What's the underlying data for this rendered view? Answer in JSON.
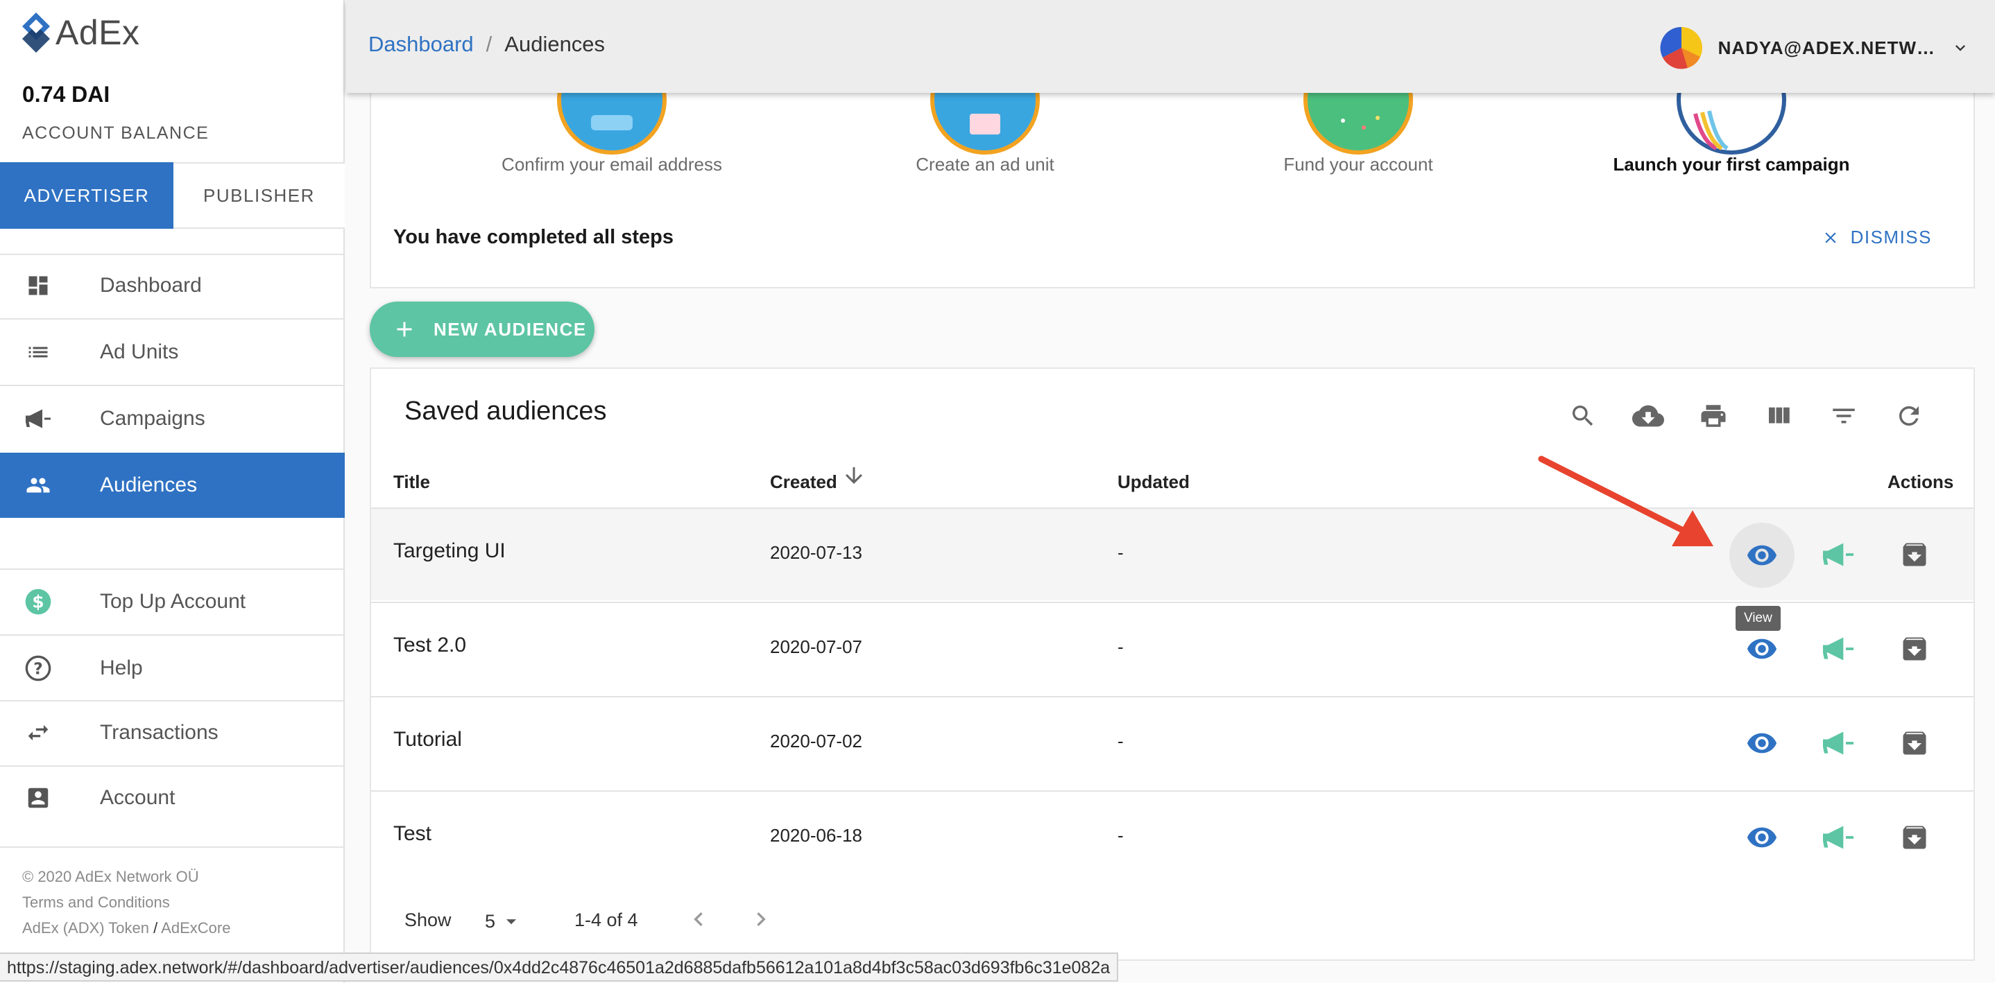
{
  "brand": {
    "name": "AdEx"
  },
  "account": {
    "balance": "0.74 DAI",
    "balance_label": "ACCOUNT BALANCE"
  },
  "mode_tabs": {
    "advertiser": "ADVERTISER",
    "publisher": "PUBLISHER"
  },
  "sidebar": {
    "items": [
      {
        "label": "Dashboard",
        "icon": "dashboard-icon"
      },
      {
        "label": "Ad Units",
        "icon": "list-icon"
      },
      {
        "label": "Campaigns",
        "icon": "megaphone-icon"
      },
      {
        "label": "Audiences",
        "icon": "people-icon",
        "active": true
      },
      {
        "label": "Top Up Account",
        "icon": "dollar-icon"
      },
      {
        "label": "Help",
        "icon": "help-icon"
      },
      {
        "label": "Transactions",
        "icon": "swap-icon"
      },
      {
        "label": "Account",
        "icon": "account-box-icon"
      }
    ]
  },
  "footer": {
    "copyright": "© 2020  AdEx Network OÜ",
    "terms": "Terms and Conditions",
    "token": "AdEx (ADX) Token",
    "slash": "/",
    "core": "AdExCore"
  },
  "breadcrumb": {
    "root": "Dashboard",
    "separator": "/",
    "current": "Audiences"
  },
  "user": {
    "email": "NADYA@ADEX.NETW…"
  },
  "onboarding": {
    "steps": [
      {
        "label": "Confirm your email address"
      },
      {
        "label": "Create an ad unit"
      },
      {
        "label": "Fund your account"
      },
      {
        "label": "Launch your first campaign"
      }
    ],
    "completed_text": "You have completed all steps",
    "dismiss": "DISMISS"
  },
  "new_audience": {
    "label": "NEW AUDIENCE"
  },
  "table": {
    "title": "Saved audiences",
    "columns": {
      "title": "Title",
      "created": "Created",
      "updated": "Updated",
      "actions": "Actions"
    },
    "rows": [
      {
        "title": "Targeting UI",
        "created": "2020-07-13",
        "updated": "-"
      },
      {
        "title": "Test 2.0",
        "created": "2020-07-07",
        "updated": "-"
      },
      {
        "title": "Tutorial",
        "created": "2020-07-02",
        "updated": "-"
      },
      {
        "title": "Test",
        "created": "2020-06-18",
        "updated": "-"
      }
    ],
    "tooltip": "View",
    "pager": {
      "show_label": "Show",
      "page_size": "5",
      "range": "1-4 of 4"
    }
  },
  "statusbar": {
    "url": "https://staging.adex.network/#/dashboard/advertiser/audiences/0x4dd2c4876c46501a2d6885dafb56612a101a8d4bf3c58ac03d693fb6c31e082a"
  },
  "colors": {
    "primary": "#2f72c3",
    "accent": "#5dc5a3",
    "arrow": "#e8432e"
  }
}
